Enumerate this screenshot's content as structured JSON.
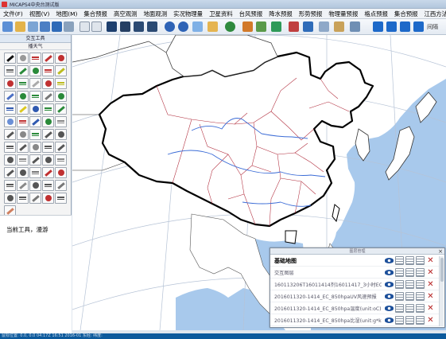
{
  "window": {
    "title": "MICAPS4中央台测试版"
  },
  "menu": [
    "文件(F)",
    "视图(V)",
    "地图(M)",
    "集合预报",
    "高空观测",
    "地面观测",
    "实况物理量",
    "卫星资料",
    "台风预报",
    "降水预报",
    "形势预报",
    "物理量预报",
    "格点预报",
    "集合预报",
    "江西方法"
  ],
  "toolbar": {
    "text_button": "间隔"
  },
  "left_panel": {
    "header": "交互工具",
    "subheader": "播天气",
    "status": "当前工具，漫游"
  },
  "layers_panel": {
    "title": "图层管理",
    "rows": [
      "基础地图",
      "交互图层",
      "160113206T16011414剂16011417_3小时EC",
      "2016011320-1414_EC_850hpaUV风速预报",
      "2016011320-1414_EC_850hpa温度(unit:oC)",
      "2016011320-1414_EC_850hpa比湿(unit:g*k"
    ]
  },
  "statusbar": {
    "text": "鼠标位置: 0.0, 0.0    04:17Z 16:51 2016-01    东经: 纬度:"
  },
  "colors": {
    "accent": "#0d5a9c",
    "land": "#ffffff",
    "sea": "#a8c9ec",
    "border": "#000000",
    "province": "#b02a3a",
    "river": "#3a6bd6"
  }
}
